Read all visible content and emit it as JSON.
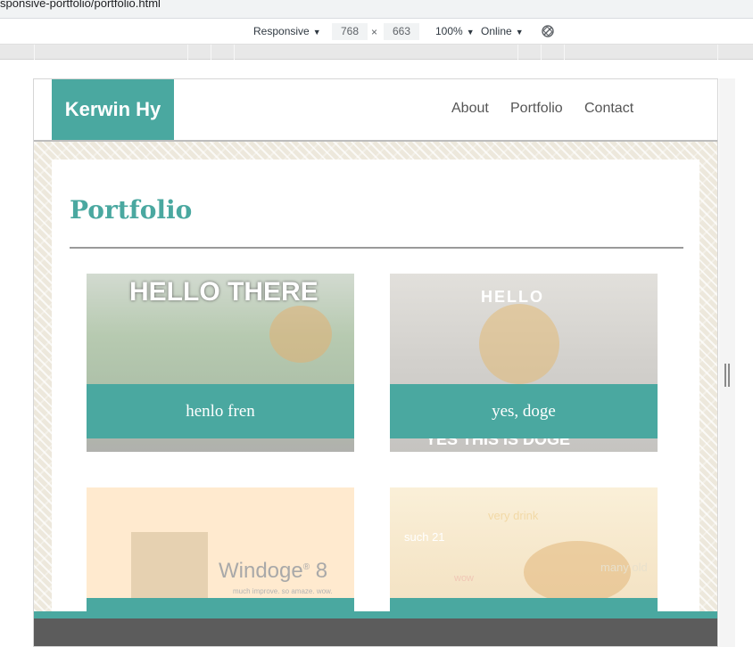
{
  "browser": {
    "url_fragment": "sponsive-portfolio/portfolio.html"
  },
  "devtools": {
    "device": "Responsive",
    "width": "768",
    "height": "663",
    "times": "×",
    "zoom": "100%",
    "network": "Online"
  },
  "site": {
    "logo": "Kerwin Hy",
    "nav": [
      "About",
      "Portfolio",
      "Contact"
    ],
    "page_title": "Portfolio",
    "cards": [
      {
        "caption": "henlo fren",
        "image_text": "HELLO THERE"
      },
      {
        "caption": "yes, doge",
        "image_text": "HELLO",
        "image_text_2": "YES THIS IS DOGE"
      },
      {
        "caption": "",
        "image_text": "Windoge",
        "image_sup": "®",
        "image_text_2": "8",
        "image_sub": "much improve. so amaze. wow."
      },
      {
        "caption": "",
        "image_text": "such 21",
        "image_text_2": "many old",
        "image_text_3": "wow",
        "image_text_4": "very drink"
      }
    ]
  },
  "colors": {
    "accent": "#4aa8a0",
    "footer": "#5c5c5c",
    "nav_text": "#555555"
  }
}
